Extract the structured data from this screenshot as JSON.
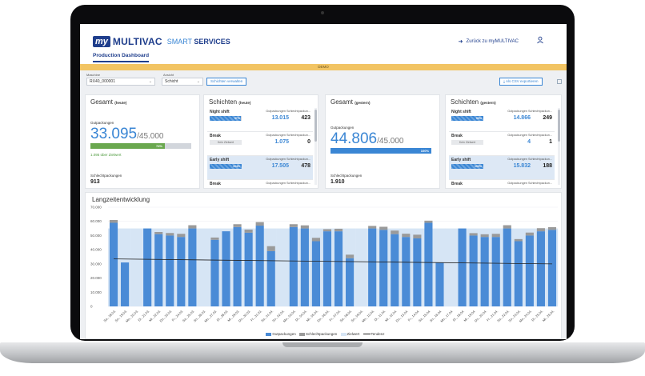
{
  "header": {
    "logo_my": "my",
    "logo_name": "MULTIVAC",
    "logo_smart": "SMART",
    "logo_services": "SERVICES",
    "back_link": "Zurück zu myMULTIVAC",
    "tab_label": "Production Dashboard",
    "demo_label": "DEMO"
  },
  "filters": {
    "machine_label": "Maschine",
    "machine_value": "RX40_000001",
    "view_label": "Ansicht",
    "view_value": "Schicht",
    "manage_button": "Schichten verwalten",
    "export_button": "Als CSV exportieren"
  },
  "today": {
    "title": "Gesamt",
    "title_suffix": "(heute)",
    "good_label": "Gutpackungen",
    "good_value": "33.095",
    "target": "/45.000",
    "progress": 74,
    "progress_label": "74%",
    "above_target": "1.095 über Zielwert",
    "scrap_label": "Schlechtpackungen",
    "scrap_value": "913"
  },
  "shifts_today": {
    "title": "Schichten",
    "title_suffix": "(heute)",
    "col_good": "Gutpackungen",
    "col_scrap": "Schlechtpackun...",
    "items": [
      {
        "name": "Night shift",
        "progress": 97,
        "progress_label": "97%",
        "good": "13.015",
        "scrap": "423"
      },
      {
        "name": "Break",
        "tag": "Kein Zielwert",
        "good": "1.075",
        "scrap": "0"
      },
      {
        "name": "Early shift",
        "progress": 100,
        "progress_label": "104%",
        "good": "17.505",
        "scrap": "478"
      },
      {
        "name": "Break",
        "good": "",
        "scrap": ""
      }
    ]
  },
  "yesterday": {
    "title": "Gesamt",
    "title_suffix": "(gestern)",
    "good_label": "Gutpackungen",
    "good_value": "44.806",
    "target": "/45.000",
    "progress": 100,
    "progress_label": "100%",
    "scrap_label": "Schlechtpackungen",
    "scrap_value": "1.910"
  },
  "shifts_yesterday": {
    "title": "Schichten",
    "title_suffix": "(gestern)",
    "col_good": "Gutpackungen",
    "col_scrap": "Schlechtpackun...",
    "items": [
      {
        "name": "Night shift",
        "progress": 99,
        "progress_label": "99%",
        "good": "14.866",
        "scrap": "249"
      },
      {
        "name": "Break",
        "tag": "Kein Zielwert",
        "good": "4",
        "scrap": "1"
      },
      {
        "name": "Early shift",
        "progress": 100,
        "progress_label": "100%",
        "good": "15.832",
        "scrap": "188"
      },
      {
        "name": "Break",
        "good": "",
        "scrap": ""
      }
    ]
  },
  "colors": {
    "accent": "#3a86d4",
    "brand": "#1f3e8c",
    "good": "#4a8bd6",
    "scrap": "#9a9a9a",
    "target": "#d6e5f5",
    "trend": "#222222",
    "demo": "#f2c463"
  },
  "chart_data": {
    "type": "bar",
    "title": "Langzeitentwicklung",
    "ylim": [
      0,
      70000
    ],
    "yticks": [
      0,
      10000,
      20000,
      30000,
      40000,
      50000,
      60000,
      70000
    ],
    "ytick_labels": [
      "0",
      "10.000",
      "20.000",
      "30.000",
      "40.000",
      "50.000",
      "60.000",
      "70.000"
    ],
    "categories": [
      "Sa., 18.03.",
      "So., 19.03.",
      "Mo., 20.03.",
      "Di., 21.03.",
      "Mi., 22.03.",
      "Do., 23.03.",
      "Fr., 24.03.",
      "Sa., 25.03.",
      "So., 26.03.",
      "Mo., 27.03.",
      "Di., 28.03.",
      "Mi., 29.03.",
      "Do., 30.03.",
      "Fr., 31.03.",
      "Sa., 01.04.",
      "So., 02.04.",
      "Mo., 03.04.",
      "Di., 04.04.",
      "Mi., 05.04.",
      "Do., 06.04.",
      "Fr., 07.04.",
      "Sa., 08.04.",
      "So., 09.04.",
      "Mo., 10.04.",
      "Di., 11.04.",
      "Mi., 12.04.",
      "Do., 13.04.",
      "Fr., 14.04.",
      "Sa., 15.04.",
      "So., 16.04.",
      "Mo., 17.04.",
      "Di., 18.04.",
      "Mi., 19.04.",
      "Do., 20.04.",
      "Fr., 21.04.",
      "Sa., 22.04.",
      "So., 23.04.",
      "Mo., 24.04.",
      "Di., 25.04.",
      "Mi., 26.04."
    ],
    "series": [
      {
        "name": "Gutpackungen",
        "values": [
          59000,
          31000,
          0,
          55000,
          51000,
          50000,
          49000,
          55000,
          0,
          47000,
          53000,
          56000,
          52000,
          57000,
          39000,
          0,
          56000,
          55000,
          46000,
          53000,
          53000,
          34000,
          0,
          55000,
          54000,
          51000,
          49000,
          48000,
          59000,
          31000,
          0,
          55000,
          50000,
          49000,
          49000,
          55000,
          46000,
          50000,
          53000,
          54000
        ]
      },
      {
        "name": "Schlechtpackungen",
        "values": [
          2000,
          0,
          0,
          0,
          1500,
          1800,
          2200,
          2300,
          0,
          1600,
          0,
          2000,
          2200,
          2500,
          3500,
          0,
          2000,
          2200,
          2400,
          1500,
          1800,
          2500,
          0,
          1800,
          2200,
          2500,
          2300,
          2600,
          1500,
          0,
          0,
          0,
          1700,
          1900,
          2200,
          2300,
          1500,
          2100,
          2200,
          1900
        ]
      },
      {
        "name": "Zielwert",
        "values": [
          55000,
          55000,
          55000,
          55000,
          55000,
          55000,
          55000,
          55000,
          55000,
          55000,
          55000,
          55000,
          55000,
          55000,
          55000,
          55000,
          55000,
          55000,
          55000,
          55000,
          55000,
          55000,
          55000,
          55000,
          55000,
          55000,
          55000,
          55000,
          55000,
          55000,
          55000,
          55000,
          55000,
          55000,
          55000,
          55000,
          55000,
          55000,
          55000,
          55000
        ]
      },
      {
        "name": "Tendenz",
        "start": 33500,
        "end": 30000
      }
    ],
    "legend": [
      "Gutpackungen",
      "Schlechtpackungen",
      "Zielwert",
      "Tendenz"
    ]
  }
}
